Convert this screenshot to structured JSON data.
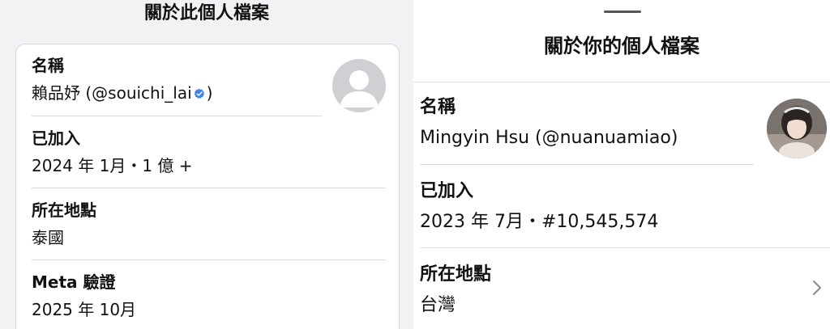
{
  "left_panel": {
    "title": "關於此個人檔案",
    "name": {
      "label": "名稱",
      "display_name": "賴品妤 (@souichi_lai",
      "close": ")",
      "verified_icon": "verified-badge-icon"
    },
    "joined": {
      "label": "已加入",
      "value": "2024 年 1月・1 億 +"
    },
    "location": {
      "label": "所在地點",
      "value": "泰國"
    },
    "meta_verified": {
      "label": "Meta 驗證",
      "value": "2025 年 10月"
    },
    "avatar_icon": "default-avatar-icon"
  },
  "right_panel": {
    "title": "關於你的個人檔案",
    "name": {
      "label": "名稱",
      "value": "Mingyin Hsu (@nuanuamiao)"
    },
    "joined": {
      "label": "已加入",
      "value": "2023 年 7月・#10,545,574"
    },
    "location": {
      "label": "所在地點",
      "value": "台灣"
    },
    "avatar_icon": "profile-photo-icon",
    "chevron_icon": "chevron-right-icon"
  },
  "colors": {
    "left_background": "#f2f2f4",
    "card_border": "#d9d9dc",
    "divider": "#dcdcdf",
    "verified_blue": "#3b82f6",
    "text": "#111111"
  }
}
